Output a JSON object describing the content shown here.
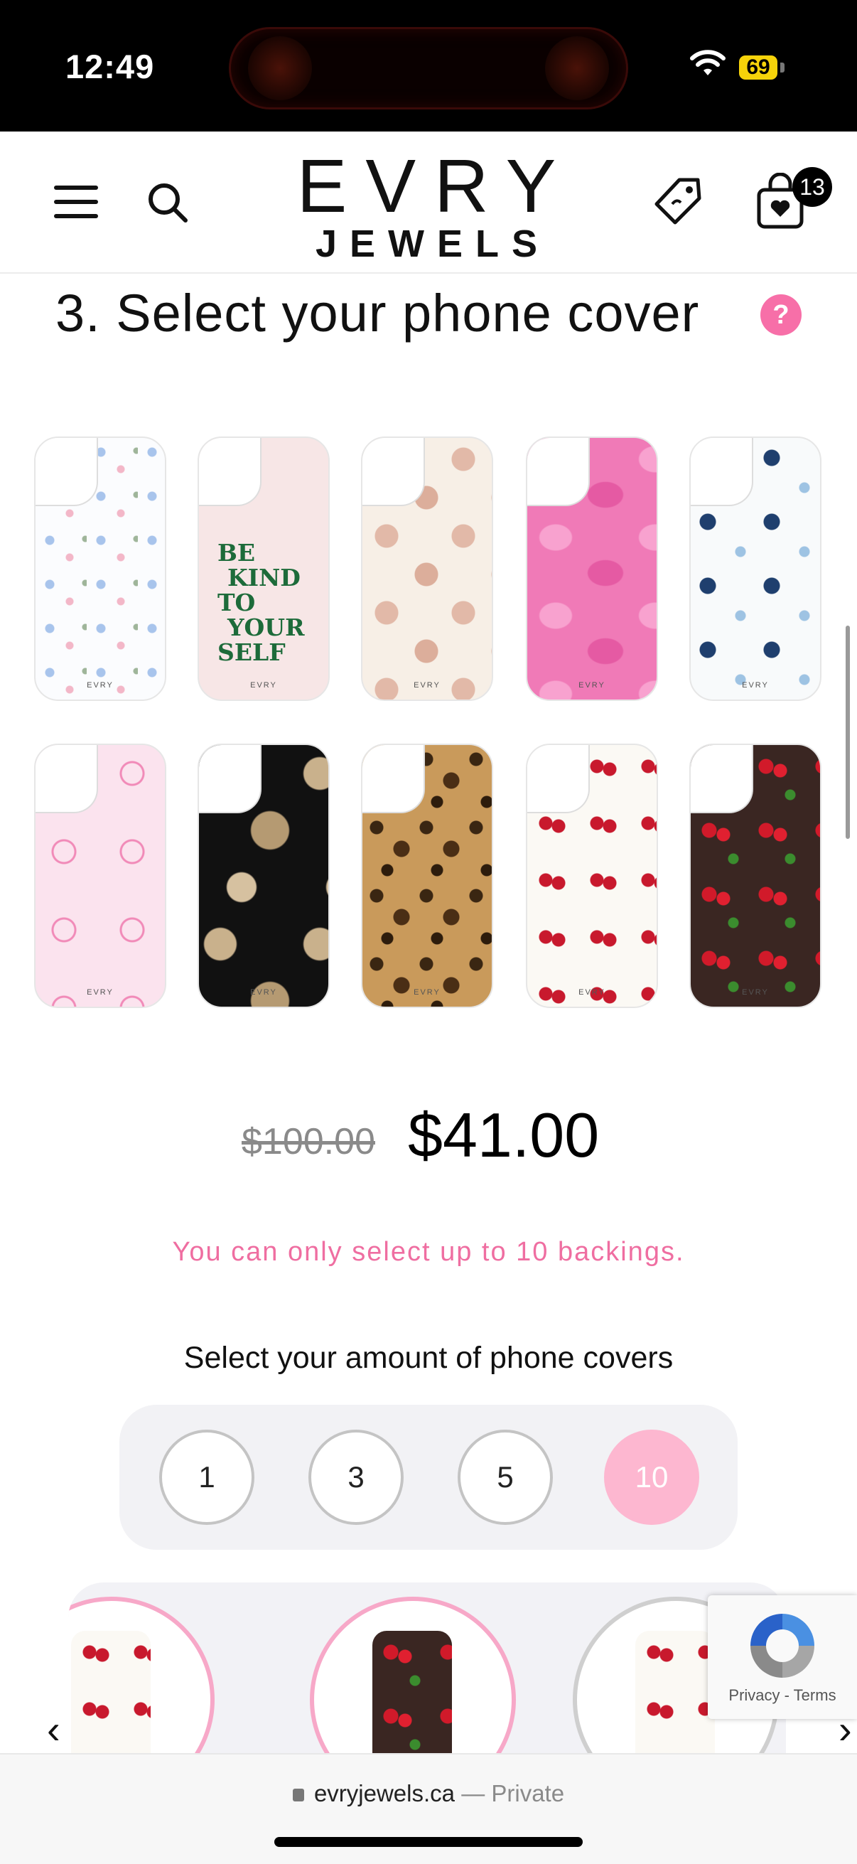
{
  "status_bar": {
    "time": "12:49",
    "battery": "69"
  },
  "header": {
    "logo_top": "EVRY",
    "logo_bottom": "JEWELS",
    "cart_count": "13"
  },
  "section": {
    "title": "3. Select your phone cover",
    "help": "?"
  },
  "covers": [
    {
      "name": "blue-bows-floral",
      "pattern": "p-bows-blue"
    },
    {
      "name": "be-kind-to-yourself",
      "pattern": "p-bekind",
      "text": [
        "BE",
        "KIND",
        "TO",
        "YOUR",
        "SELF"
      ]
    },
    {
      "name": "teddy-bears",
      "pattern": "p-bears"
    },
    {
      "name": "pink-lips",
      "pattern": "p-lips"
    },
    {
      "name": "blueberries-bows",
      "pattern": "p-blueberry"
    },
    {
      "name": "pink-bows",
      "pattern": "p-bows-pink"
    },
    {
      "name": "leopard-stars",
      "pattern": "p-stars"
    },
    {
      "name": "leopard-print",
      "pattern": "p-leopard"
    },
    {
      "name": "cherries-white",
      "pattern": "p-cherry-white"
    },
    {
      "name": "cherries-brown",
      "pattern": "p-cherry-brown"
    }
  ],
  "cover_brand": "EVRY",
  "price": {
    "original": "$100.00",
    "current": "$41.00"
  },
  "limit_message": "You can only select up to 10 backings.",
  "amount": {
    "label": "Select your amount of phone covers",
    "options": [
      "1",
      "3",
      "5",
      "10"
    ],
    "selected": "10"
  },
  "carousel": {
    "prev": "‹",
    "next": "›"
  },
  "recaptcha": {
    "links": "Privacy - Terms"
  },
  "urlbar": {
    "domain": "evryjewels.ca",
    "mode": "— Private"
  },
  "colors": {
    "accent_pink": "#f76fa8",
    "selected_pink": "#fdb7d0",
    "message_pink": "#ef6ea1"
  }
}
